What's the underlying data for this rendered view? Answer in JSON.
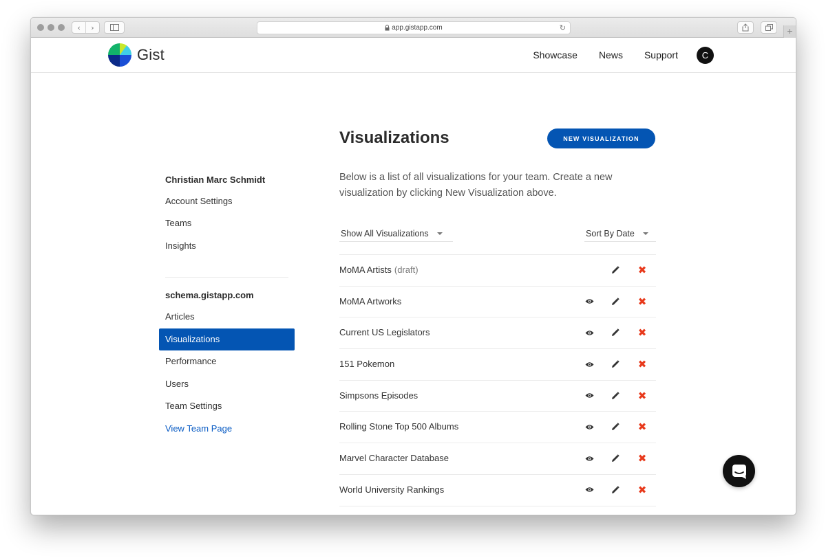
{
  "browser": {
    "url": "app.gistapp.com"
  },
  "header": {
    "logo_text": "Gist",
    "nav": [
      "Showcase",
      "News",
      "Support"
    ],
    "avatar_initial": "C"
  },
  "sidebar": {
    "user_heading": "Christian Marc Schmidt",
    "user_items": [
      "Account Settings",
      "Teams",
      "Insights"
    ],
    "team_heading": "schema.gistapp.com",
    "team_items": [
      "Articles",
      "Visualizations",
      "Performance",
      "Users",
      "Team Settings"
    ],
    "active_item": "Visualizations",
    "team_link": "View Team Page"
  },
  "main": {
    "title": "Visualizations",
    "new_button": "NEW VISUALIZATION",
    "intro": "Below is a list of all visualizations for your team. Create a new visualization by clicking New Visualization above.",
    "filter": "Show All Visualizations",
    "sort": "Sort By Date",
    "visualizations": [
      {
        "name": "MoMA Artists",
        "tag": "(draft)",
        "viewable": false
      },
      {
        "name": "MoMA Artworks",
        "tag": "",
        "viewable": true
      },
      {
        "name": "Current US Legislators",
        "tag": "",
        "viewable": true
      },
      {
        "name": "151 Pokemon",
        "tag": "",
        "viewable": true
      },
      {
        "name": "Simpsons Episodes",
        "tag": "",
        "viewable": true
      },
      {
        "name": "Rolling Stone Top 500 Albums",
        "tag": "",
        "viewable": true
      },
      {
        "name": "Marvel Character Database",
        "tag": "",
        "viewable": true
      },
      {
        "name": "World University Rankings",
        "tag": "",
        "viewable": true
      }
    ]
  },
  "colors": {
    "accent": "#0455b3",
    "delete": "#e8391b",
    "link": "#0a5cc4"
  },
  "icons": {
    "view": "eye-icon",
    "edit": "pencil-icon",
    "delete": "close-icon",
    "chat": "chat-icon"
  }
}
